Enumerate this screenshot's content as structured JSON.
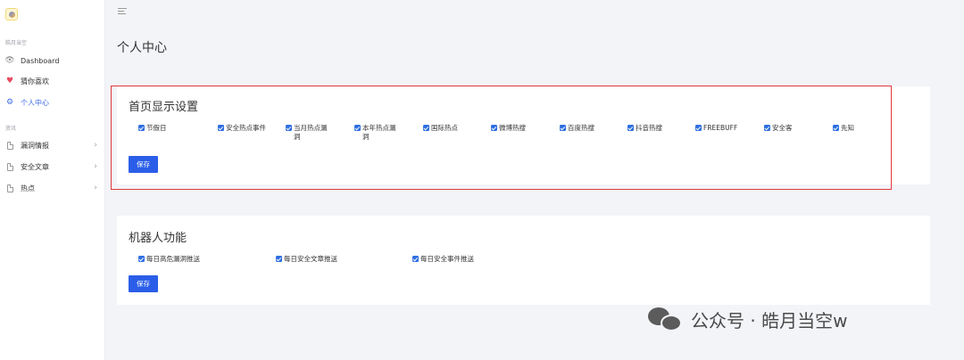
{
  "sidebar": {
    "group1": "皓月当空",
    "items1": [
      {
        "label": "Dashboard",
        "icon": "eye-icon"
      },
      {
        "label": "猜你喜欢",
        "icon": "heart-icon"
      },
      {
        "label": "个人中心",
        "icon": "gear-icon"
      }
    ],
    "group2": "资讯",
    "items2": [
      {
        "label": "漏洞情报",
        "icon": "file-icon"
      },
      {
        "label": "安全文章",
        "icon": "file-icon"
      },
      {
        "label": "热点",
        "icon": "file-icon"
      }
    ]
  },
  "page": {
    "title": "个人中心"
  },
  "homepage_settings": {
    "title": "首页显示设置",
    "options": [
      {
        "label": "节假日",
        "checked": true
      },
      {
        "label": "安全热点事件",
        "checked": true
      },
      {
        "label": "当月热点漏洞",
        "checked": true
      },
      {
        "label": "本年热点漏洞",
        "checked": true
      },
      {
        "label": "国际热点",
        "checked": true
      },
      {
        "label": "微博热搜",
        "checked": true
      },
      {
        "label": "百度热搜",
        "checked": true
      },
      {
        "label": "抖音热搜",
        "checked": true
      },
      {
        "label": "FREEBUFF",
        "checked": true
      },
      {
        "label": "安全客",
        "checked": true
      },
      {
        "label": "先知",
        "checked": true
      }
    ],
    "save_label": "保存"
  },
  "robot": {
    "title": "机器人功能",
    "options": [
      {
        "label": "每日高危漏洞推送",
        "checked": true
      },
      {
        "label": "每日安全文章推送",
        "checked": true
      },
      {
        "label": "每日安全事件推送",
        "checked": true
      }
    ],
    "save_label": "保存"
  },
  "watermark": {
    "text": "公众号 · 皓月当空w"
  },
  "colors": {
    "accent": "#2b5ee8",
    "highlight": "#e0393c",
    "heart": "#e84a5f"
  }
}
